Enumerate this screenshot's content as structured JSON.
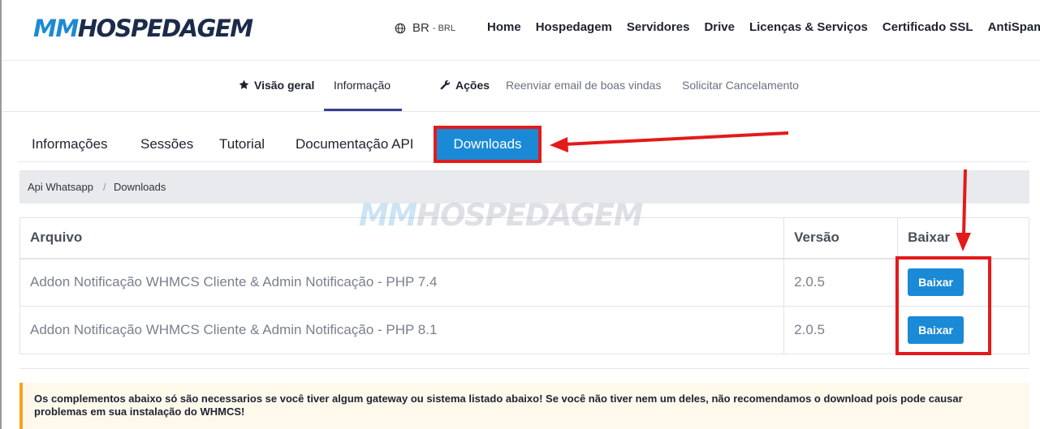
{
  "header": {
    "logo_mm": "MM",
    "logo_rest": "HOSPEDAGEM",
    "locale": "BR",
    "currency": "- BRL",
    "nav": [
      "Home",
      "Hospedagem",
      "Servidores",
      "Drive",
      "Licenças & Serviços",
      "Certificado SSL",
      "AntiSpam"
    ]
  },
  "subnav": {
    "overview": "Visão geral",
    "info": "Informação",
    "actions": "Ações",
    "resend": "Reenviar email de boas vindas",
    "cancel": "Solicitar Cancelamento"
  },
  "tabs": {
    "informacoes": "Informações",
    "sessoes": "Sessões",
    "tutorial": "Tutorial",
    "api": "Documentação API",
    "downloads": "Downloads"
  },
  "breadcrumb": [
    "Api Whatsapp",
    "Downloads"
  ],
  "breadcrumb_sep": "/",
  "watermark": {
    "mm": "MM",
    "rest": "HOSPEDAGEM"
  },
  "table": {
    "headers": [
      "Arquivo",
      "Versão",
      "Baixar"
    ],
    "rows": [
      {
        "file": "Addon Notificação WHMCS Cliente & Admin Notificação - PHP 7.4",
        "version": "2.0.5",
        "button": "Baixar"
      },
      {
        "file": "Addon Notificação WHMCS Cliente & Admin Notificação - PHP 8.1",
        "version": "2.0.5",
        "button": "Baixar"
      }
    ]
  },
  "notice": "Os complementos abaixo só são necessarios se você tiver algum gateway ou sistema listado abaixo! Se você não tiver nem um deles, não recomendamos o download pois pode causar problemas em sua instalação do WHMCS!",
  "colors": {
    "accent": "#1a8ad6",
    "highlight": "#e41a1a",
    "warning": "#f7a21c",
    "logo_dark": "#1c2b4a"
  }
}
